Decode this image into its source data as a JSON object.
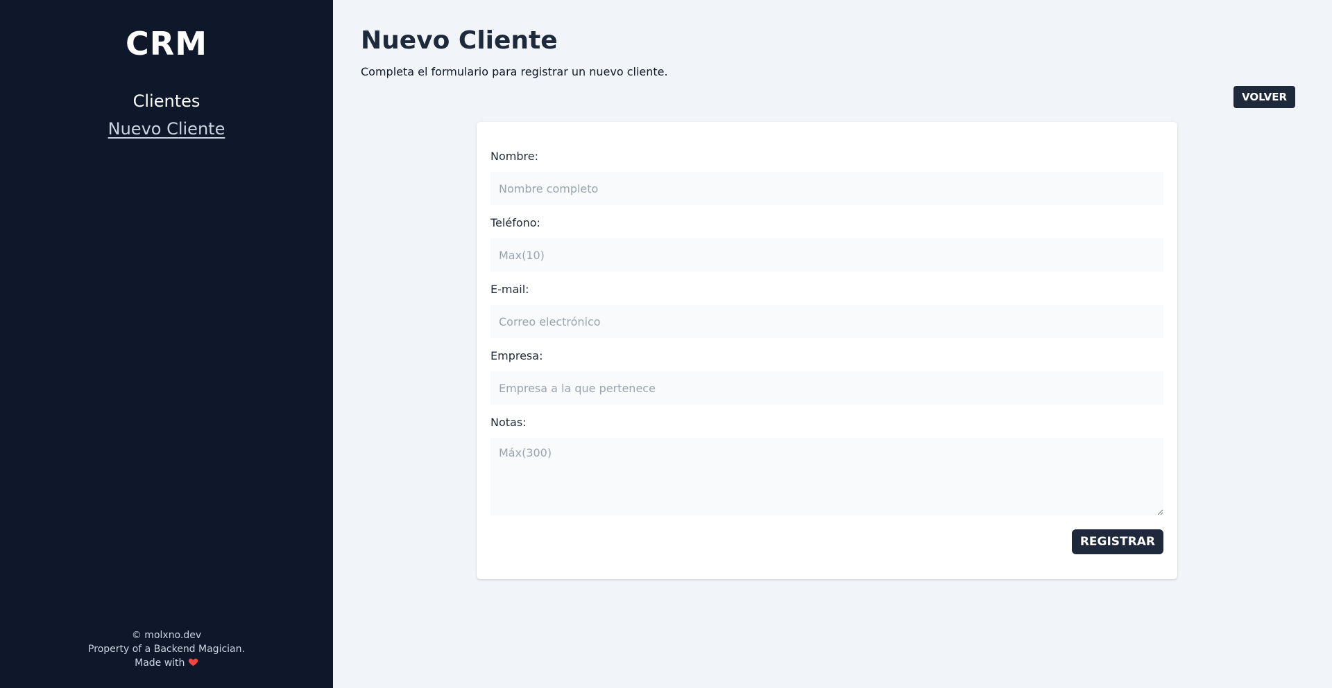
{
  "sidebar": {
    "brand": "CRM",
    "nav": [
      {
        "label": "Clientes"
      },
      {
        "label": "Nuevo Cliente"
      }
    ],
    "footer": {
      "line1": "© molxno.dev",
      "line2": "Property of a Backend Magician.",
      "line3": "Made with"
    }
  },
  "main": {
    "title": "Nuevo Cliente",
    "subtitle": "Completa el formulario para registrar un nuevo cliente.",
    "back_label": "VOLVER",
    "form": {
      "fields": [
        {
          "label": "Nombre:",
          "placeholder": "Nombre completo",
          "value": ""
        },
        {
          "label": "Teléfono:",
          "placeholder": "Max(10)",
          "value": ""
        },
        {
          "label": "E-mail:",
          "placeholder": "Correo electrónico",
          "value": ""
        },
        {
          "label": "Empresa:",
          "placeholder": "Empresa a la que pertenece",
          "value": ""
        },
        {
          "label": "Notas:",
          "placeholder": "Máx(300)",
          "value": ""
        }
      ],
      "submit_label": "REGISTRAR"
    }
  },
  "colors": {
    "sidebar_bg": "#0f172a",
    "main_bg": "#f1f5f9",
    "button_bg": "#1e293b",
    "heart": "#ef4444"
  }
}
